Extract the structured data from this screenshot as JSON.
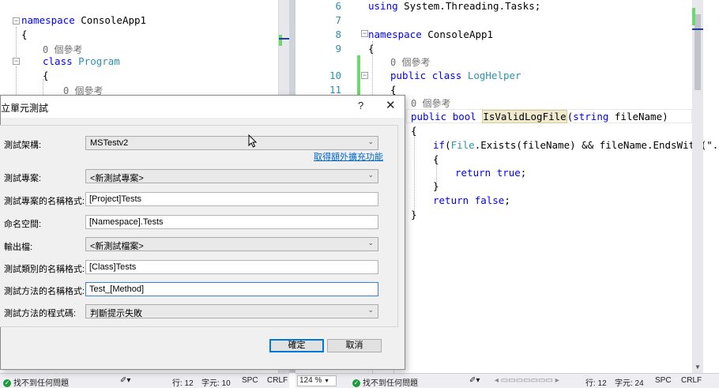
{
  "left_editor": {
    "lines": [
      {
        "indent": 0,
        "parts": [
          {
            "t": "namespace ",
            "c": "kw"
          },
          {
            "t": "ConsoleApp1",
            "c": ""
          }
        ]
      },
      {
        "indent": 0,
        "parts": [
          {
            "t": "{",
            "c": ""
          }
        ]
      },
      {
        "indent": 1,
        "parts": [
          {
            "t": "0 個參考",
            "c": "cl"
          }
        ]
      },
      {
        "indent": 1,
        "parts": [
          {
            "t": "class ",
            "c": "kw"
          },
          {
            "t": "Program",
            "c": "ty"
          }
        ]
      },
      {
        "indent": 1,
        "parts": [
          {
            "t": "{",
            "c": ""
          }
        ]
      },
      {
        "indent": 2,
        "parts": [
          {
            "t": "0 個參考",
            "c": "cl"
          }
        ]
      }
    ]
  },
  "right_editor": {
    "lines": [
      {
        "num": "6",
        "text_parts": [
          {
            "t": "using ",
            "c": "kw"
          },
          {
            "t": "System.Threading.Tasks;",
            "c": ""
          }
        ]
      },
      {
        "num": "7",
        "text_parts": []
      },
      {
        "num": "8",
        "text_parts": [
          {
            "t": "namespace ",
            "c": "kw"
          },
          {
            "t": "ConsoleApp1",
            "c": ""
          }
        ]
      },
      {
        "num": "9",
        "text_parts": [
          {
            "t": "{",
            "c": ""
          }
        ]
      },
      {
        "num": "",
        "text_parts": [
          {
            "t": "0 個參考",
            "c": "cl"
          }
        ]
      },
      {
        "num": "10",
        "text_parts": [
          {
            "t": "public ",
            "c": "kw"
          },
          {
            "t": "class ",
            "c": "kw"
          },
          {
            "t": "LogHelper",
            "c": "ty"
          }
        ]
      },
      {
        "num": "11",
        "text_parts": [
          {
            "t": "{",
            "c": ""
          }
        ]
      },
      {
        "num": "",
        "text_parts": [
          {
            "t": "0 個參考",
            "c": "cl"
          }
        ]
      },
      {
        "num": "",
        "text_parts": [
          {
            "t": "public ",
            "c": "kw"
          },
          {
            "t": "bool ",
            "c": "kw"
          },
          {
            "t": "IsValidLogFile",
            "c": "hl"
          },
          {
            "t": "(",
            "c": ""
          },
          {
            "t": "string ",
            "c": "kw"
          },
          {
            "t": "fileName)",
            "c": ""
          }
        ]
      },
      {
        "num": "",
        "text_parts": [
          {
            "t": "{",
            "c": ""
          }
        ]
      },
      {
        "num": "",
        "text_parts": [
          {
            "t": "if",
            "c": "kw"
          },
          {
            "t": "(",
            "c": ""
          },
          {
            "t": "File",
            "c": "ty"
          },
          {
            "t": ".Exists(fileName) && fileName.EndsWith(\".l",
            "c": ""
          }
        ]
      },
      {
        "num": "",
        "text_parts": [
          {
            "t": "{",
            "c": ""
          }
        ]
      },
      {
        "num": "",
        "text_parts": [
          {
            "t": "return ",
            "c": "kw"
          },
          {
            "t": "true",
            "c": "kw"
          },
          {
            "t": ";",
            "c": ""
          }
        ]
      },
      {
        "num": "",
        "text_parts": [
          {
            "t": "}",
            "c": ""
          }
        ]
      },
      {
        "num": "",
        "text_parts": [
          {
            "t": "return ",
            "c": "kw"
          },
          {
            "t": "false",
            "c": "kw"
          },
          {
            "t": ";",
            "c": ""
          }
        ]
      },
      {
        "num": "",
        "text_parts": [
          {
            "t": "}",
            "c": ""
          }
        ]
      }
    ]
  },
  "dialog": {
    "title": "立單元測試",
    "help": "?",
    "close": "✕",
    "fields": {
      "framework_label": "測試架構:",
      "framework_value": "MSTestv2",
      "ext_link": "取得額外擴充功能",
      "project_label": "測試專案:",
      "project_value": "<新測試專案>",
      "project_name_format_label": "測試專案的名稱格式:",
      "project_name_format_value": "[Project]Tests",
      "namespace_label": "命名空間:",
      "namespace_value": "[Namespace].Tests",
      "output_file_label": "輸出檔:",
      "output_file_value": "<新測試檔案>",
      "class_name_format_label": "測試類別的名稱格式:",
      "class_name_format_value": "[Class]Tests",
      "method_name_format_label": "測試方法的名稱格式:",
      "method_name_format_value": "Test_[Method]",
      "method_code_label": "測試方法的程式碼:",
      "method_code_value": "判斷提示失敗"
    },
    "ok_label": "確定",
    "cancel_label": "取消"
  },
  "status_left": {
    "issues": "找不到任何問題",
    "line": "行: 12",
    "char": "字元: 10",
    "spc": "SPC",
    "crlf": "CRLF"
  },
  "status_right": {
    "zoom": "124 %",
    "issues": "找不到任何問題",
    "line": "行: 12",
    "char": "字元: 24",
    "spc": "SPC",
    "crlf": "CRLF"
  },
  "colors": {
    "keyword": "#0000ff",
    "type": "#2b91af",
    "accent": "#0078d7"
  }
}
